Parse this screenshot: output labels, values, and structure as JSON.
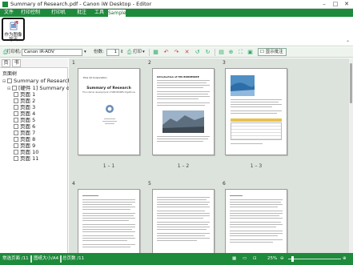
{
  "window": {
    "title": "Summary of Research.pdf - Canon iW Desktop - Editor",
    "min": "–",
    "max": "□",
    "close": "✕"
  },
  "menu": [
    "文件",
    "打印控制",
    "打印机",
    "批注",
    "工具",
    "Sample"
  ],
  "ribbon": {
    "button_label": "作为图像导出"
  },
  "toolbar": {
    "printer_label": "打印机:",
    "printer_value": "Canon iR-ADV",
    "copies_label": "份数:",
    "copies_value": "1",
    "print_label": "打印",
    "show_annotation": "显示批注"
  },
  "sidebar": {
    "tab1": "页",
    "tab2": "书",
    "header": "页面树",
    "tree": [
      {
        "label": "Summary of Research",
        "toggle": "▣"
      },
      {
        "label": "[硬件 1] Summary of Re",
        "toggle": "▣"
      },
      {
        "label": "页面 1",
        "toggle": ""
      },
      {
        "label": "页面 2",
        "toggle": ""
      },
      {
        "label": "页面 3",
        "toggle": ""
      },
      {
        "label": "页面 4",
        "toggle": ""
      },
      {
        "label": "页面 5",
        "toggle": ""
      },
      {
        "label": "页面 6",
        "toggle": ""
      },
      {
        "label": "页面 7",
        "toggle": ""
      },
      {
        "label": "页面 8",
        "toggle": ""
      },
      {
        "label": "页面 9",
        "toggle": ""
      },
      {
        "label": "页面 10",
        "toggle": ""
      },
      {
        "label": "页面 11",
        "toggle": ""
      }
    ]
  },
  "pages": [
    {
      "num": "1",
      "caption": "1 – 1",
      "company": "Pins 10 Corporation",
      "title": "Summary of Research",
      "subtitle": "The internal development of SMP BIORES Orgathone"
    },
    {
      "num": "2",
      "caption": "1 – 2",
      "heading": "Introduction of HIS BORNMORE"
    },
    {
      "num": "3",
      "caption": "1 – 3"
    },
    {
      "num": "4",
      "caption": ""
    },
    {
      "num": "5",
      "caption": ""
    },
    {
      "num": "6",
      "caption": ""
    }
  ],
  "status": {
    "page_info": "常选页面 /11",
    "page_size": "图纸大小/A4",
    "total_pages": "总页数 /11",
    "zoom": "25%"
  },
  "colors": {
    "accent": "#1e8a3b",
    "content_bg": "#dce2dc"
  }
}
